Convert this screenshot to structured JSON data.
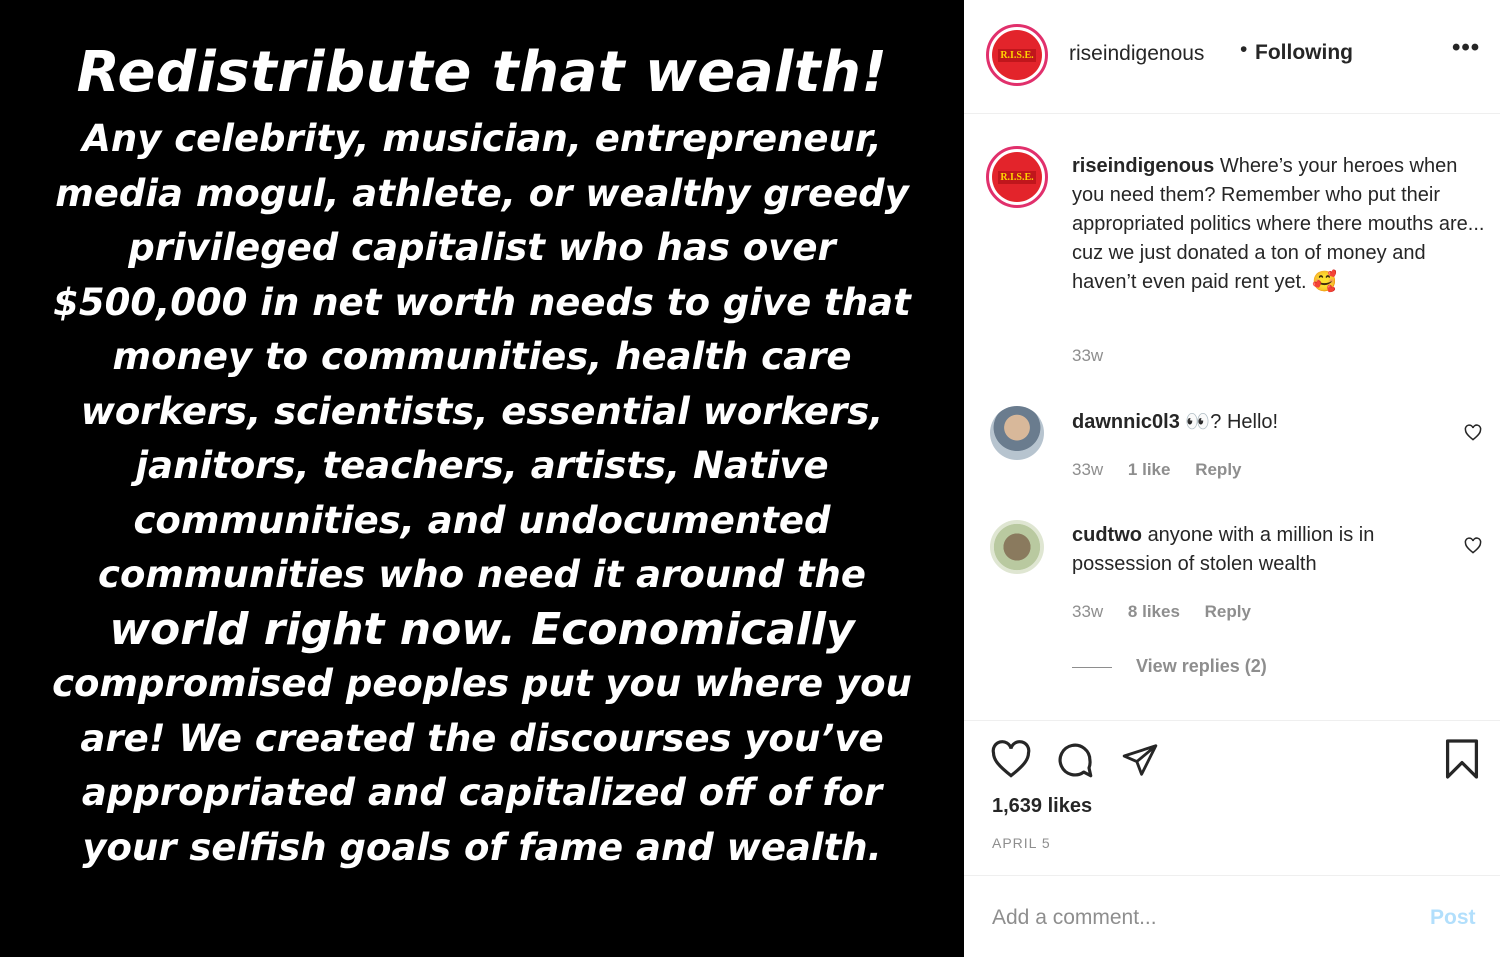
{
  "post_image": {
    "headline": "Redistribute that wealth!",
    "lines": [
      "Any celebrity, musician, entrepreneur,",
      "media mogul, athlete, or wealthy greedy",
      "privileged capitalist who has over",
      "$500,000 in net worth needs to give that",
      "money to communities, health care",
      "workers, scientists, essential workers,",
      "janitors, teachers, artists, Native",
      "communities, and undocumented",
      "communities who need it around the",
      "world right now. Economically",
      "compromised peoples  put you where you",
      "are! We created the discourses you’ve",
      "appropriated and capitalized off of for",
      "your selfish goals of fame and wealth."
    ]
  },
  "header": {
    "avatar_text": "R.I.S.E.",
    "username": "riseindigenous",
    "separator": "•",
    "follow_status": "Following",
    "more_icon": "more-options-icon"
  },
  "caption": {
    "username": "riseindigenous",
    "text": "Where’s your heroes when you need them? Remember who put their appropriated politics where there mouths are... cuz we just donated a ton of money and haven’t even paid rent yet. 🥰",
    "time": "33w"
  },
  "comments": [
    {
      "username": "dawnnic0l3",
      "text": "👀? Hello!",
      "time": "33w",
      "likes": "1 like",
      "reply": "Reply"
    },
    {
      "username": "cudtwo",
      "text": "anyone with a million is in possession of stolen wealth",
      "time": "33w",
      "likes": "8 likes",
      "reply": "Reply",
      "view_replies": "View replies (2)"
    }
  ],
  "actions": {
    "likes": "1,639 likes",
    "date": "APRIL 5"
  },
  "add_comment": {
    "placeholder": "Add a comment...",
    "post_label": "Post"
  },
  "colors": {
    "text": "#262626",
    "muted": "#8e8e8e",
    "post_button": "#b2dffc",
    "avatar_ring": "#e1306c"
  }
}
